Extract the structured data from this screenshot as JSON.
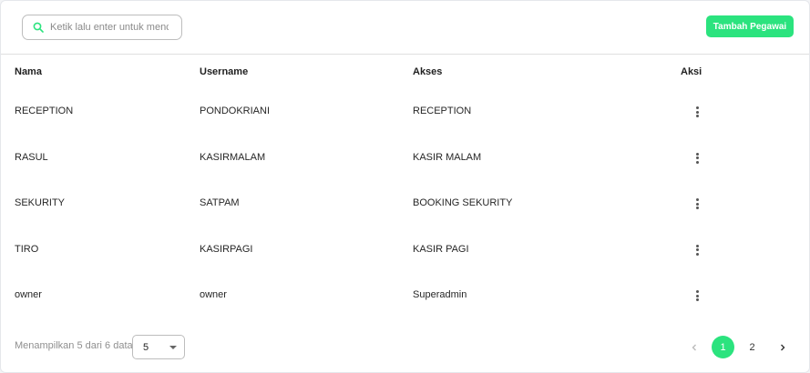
{
  "search": {
    "placeholder": "Ketik lalu enter untuk mencari"
  },
  "toolbar": {
    "add_label": "Tambah Pegawai"
  },
  "colors": {
    "accent": "#2be37e"
  },
  "table": {
    "headers": [
      "Nama",
      "Username",
      "Akses",
      "Aksi"
    ],
    "rows": [
      {
        "nama": "RECEPTION",
        "username": "PONDOKRIANI",
        "akses": "RECEPTION"
      },
      {
        "nama": "RASUL",
        "username": "KASIRMALAM",
        "akses": "KASIR MALAM"
      },
      {
        "nama": "SEKURITY",
        "username": "SATPAM",
        "akses": "BOOKING SEKURITY"
      },
      {
        "nama": "TIRO",
        "username": "KASIRPAGI",
        "akses": "KASIR PAGI"
      },
      {
        "nama": "owner",
        "username": "owner",
        "akses": "Superadmin"
      }
    ]
  },
  "footer": {
    "info": "Menampilkan 5 dari 6 data",
    "page_size": "5",
    "pages": [
      "1",
      "2"
    ],
    "current_page": "1"
  }
}
